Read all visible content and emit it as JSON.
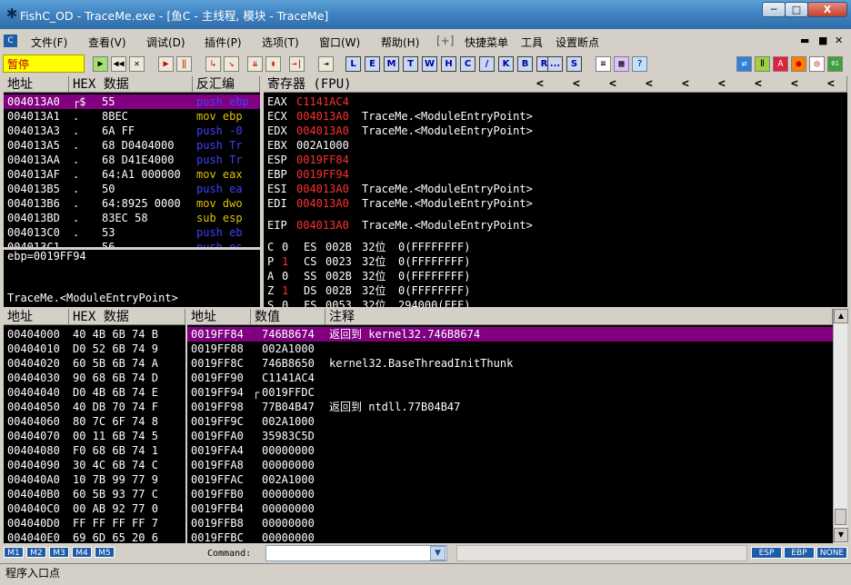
{
  "window": {
    "title": "FishC_OD - TraceMe.exe - [鱼C - 主线程, 模块 - TraceMe]",
    "app_icon": "bug-icon",
    "min": "─",
    "max": "□",
    "close": "X"
  },
  "menu": {
    "items": [
      "文件(F)",
      "查看(V)",
      "调试(D)",
      "插件(P)",
      "选项(T)",
      "窗口(W)",
      "帮助(H)",
      "[+]",
      "快捷菜单",
      "工具",
      "设置断点"
    ],
    "mdi_min": "▬",
    "mdi_max": "■",
    "mdi_close": "✕"
  },
  "toolbar": {
    "status": "暂停",
    "buttons": [
      "▶",
      "◀◀",
      "✕",
      "▶",
      "‖",
      "↳",
      "↘",
      "⇊",
      "⇟",
      "→|",
      "⇥"
    ],
    "letters": [
      "L",
      "E",
      "M",
      "T",
      "W",
      "H",
      "C",
      "/",
      "K",
      "B",
      "R",
      "...",
      "S"
    ],
    "right_icons": [
      "list-icon",
      "grid-icon",
      "help-icon",
      "refresh-icon",
      "bars-icon",
      "a-icon",
      "record-icon",
      "target-icon",
      "binary-icon"
    ]
  },
  "disasm": {
    "headers": [
      "地址",
      "HEX 数据",
      "反汇编"
    ],
    "rows": [
      {
        "addr": "004013A0",
        "mark": "┌$",
        "hex": "55",
        "asm": "push ebp",
        "color": "blue"
      },
      {
        "addr": "004013A1",
        "mark": ".",
        "hex": "8BEC",
        "asm": "mov ebp",
        "color": "yellow"
      },
      {
        "addr": "004013A3",
        "mark": ".",
        "hex": "6A FF",
        "asm": "push -0",
        "color": "blue"
      },
      {
        "addr": "004013A5",
        "mark": ".",
        "hex": "68 D0404000",
        "asm": "push Tr",
        "color": "blue"
      },
      {
        "addr": "004013AA",
        "mark": ".",
        "hex": "68 D41E4000",
        "asm": "push Tr",
        "color": "blue"
      },
      {
        "addr": "004013AF",
        "mark": ".",
        "hex": "64:A1 000000",
        "asm": "mov eax",
        "color": "yellow"
      },
      {
        "addr": "004013B5",
        "mark": ".",
        "hex": "50",
        "asm": "push ea",
        "color": "blue"
      },
      {
        "addr": "004013B6",
        "mark": ".",
        "hex": "64:8925 0000",
        "asm": "mov dwo",
        "color": "yellow"
      },
      {
        "addr": "004013BD",
        "mark": ".",
        "hex": "83EC 58",
        "asm": "sub esp",
        "color": "yellow"
      },
      {
        "addr": "004013C0",
        "mark": ".",
        "hex": "53",
        "asm": "push eb",
        "color": "blue"
      },
      {
        "addr": "004013C1",
        "mark": ".",
        "hex": "56",
        "asm": "push es",
        "color": "blue"
      }
    ],
    "info_line1": "ebp=0019FF94",
    "info_line2": "TraceMe.<ModuleEntryPoint>"
  },
  "registers": {
    "header": "寄存器 (FPU)",
    "arrows": [
      "<",
      "<",
      "<",
      "<",
      "<",
      "<",
      "<",
      "<",
      "<"
    ],
    "regs": [
      {
        "name": "EAX",
        "value": "C1141AC4",
        "desc": "",
        "red": true
      },
      {
        "name": "ECX",
        "value": "004013A0",
        "desc": "TraceMe.<ModuleEntryPoint>",
        "red": true
      },
      {
        "name": "EDX",
        "value": "004013A0",
        "desc": "TraceMe.<ModuleEntryPoint>",
        "red": true
      },
      {
        "name": "EBX",
        "value": "002A1000",
        "desc": "",
        "red": false
      },
      {
        "name": "ESP",
        "value": "0019FF84",
        "desc": "",
        "red": true
      },
      {
        "name": "EBP",
        "value": "0019FF94",
        "desc": "",
        "red": true
      },
      {
        "name": "ESI",
        "value": "004013A0",
        "desc": "TraceMe.<ModuleEntryPoint>",
        "red": true
      },
      {
        "name": "EDI",
        "value": "004013A0",
        "desc": "TraceMe.<ModuleEntryPoint>",
        "red": true
      }
    ],
    "eip": {
      "name": "EIP",
      "value": "004013A0",
      "desc": "TraceMe.<ModuleEntryPoint>"
    },
    "flags": [
      {
        "f": "C",
        "v": "0",
        "seg": "ES",
        "sel": "002B",
        "bits": "32位",
        "rest": "0(FFFFFFFF)",
        "red": false
      },
      {
        "f": "P",
        "v": "1",
        "seg": "CS",
        "sel": "0023",
        "bits": "32位",
        "rest": "0(FFFFFFFF)",
        "red": true
      },
      {
        "f": "A",
        "v": "0",
        "seg": "SS",
        "sel": "002B",
        "bits": "32位",
        "rest": "0(FFFFFFFF)",
        "red": false
      },
      {
        "f": "Z",
        "v": "1",
        "seg": "DS",
        "sel": "002B",
        "bits": "32位",
        "rest": "0(FFFFFFFF)",
        "red": true
      },
      {
        "f": "S",
        "v": "0",
        "seg": "FS",
        "sel": "0053",
        "bits": "32位",
        "rest": "294000(FFF)",
        "red": false
      }
    ]
  },
  "dump": {
    "headers": [
      "地址",
      "HEX 数据"
    ],
    "rows": [
      {
        "addr": "00404000",
        "hex": "40 4B 6B 74 B"
      },
      {
        "addr": "00404010",
        "hex": "D0 52 6B 74 9"
      },
      {
        "addr": "00404020",
        "hex": "60 5B 6B 74 A"
      },
      {
        "addr": "00404030",
        "hex": "90 68 6B 74 D"
      },
      {
        "addr": "00404040",
        "hex": "D0 4B 6B 74 E"
      },
      {
        "addr": "00404050",
        "hex": "40 DB 70 74 F"
      },
      {
        "addr": "00404060",
        "hex": "80 7C 6F 74 8"
      },
      {
        "addr": "00404070",
        "hex": "00 11 6B 74 5"
      },
      {
        "addr": "00404080",
        "hex": "F0 68 6B 74 1"
      },
      {
        "addr": "00404090",
        "hex": "30 4C 6B 74 C"
      },
      {
        "addr": "004040A0",
        "hex": "10 7B 99 77 9"
      },
      {
        "addr": "004040B0",
        "hex": "60 5B 93 77 C"
      },
      {
        "addr": "004040C0",
        "hex": "00 AB 92 77 0"
      },
      {
        "addr": "004040D0",
        "hex": "FF FF FF FF 7"
      },
      {
        "addr": "004040E0",
        "hex": "69 6D 65 20 6"
      }
    ]
  },
  "stack": {
    "headers": [
      "地址",
      "数值",
      "注释"
    ],
    "rows": [
      {
        "addr": "0019FF84",
        "mark": "",
        "val": "746B8674",
        "note": "返回到 kernel32.746B8674"
      },
      {
        "addr": "0019FF88",
        "mark": "",
        "val": "002A1000",
        "note": ""
      },
      {
        "addr": "0019FF8C",
        "mark": "",
        "val": "746B8650",
        "note": "kernel32.BaseThreadInitThunk"
      },
      {
        "addr": "0019FF90",
        "mark": "",
        "val": "C1141AC4",
        "note": ""
      },
      {
        "addr": "0019FF94",
        "mark": "┌",
        "val": "0019FFDC",
        "note": ""
      },
      {
        "addr": "0019FF98",
        "mark": "",
        "val": "77B04B47",
        "note": "返回到 ntdll.77B04B47"
      },
      {
        "addr": "0019FF9C",
        "mark": "",
        "val": "002A1000",
        "note": ""
      },
      {
        "addr": "0019FFA0",
        "mark": "",
        "val": "35983C5D",
        "note": ""
      },
      {
        "addr": "0019FFA4",
        "mark": "",
        "val": "00000000",
        "note": ""
      },
      {
        "addr": "0019FFA8",
        "mark": "",
        "val": "00000000",
        "note": ""
      },
      {
        "addr": "0019FFAC",
        "mark": "",
        "val": "002A1000",
        "note": ""
      },
      {
        "addr": "0019FFB0",
        "mark": "",
        "val": "00000000",
        "note": ""
      },
      {
        "addr": "0019FFB4",
        "mark": "",
        "val": "00000000",
        "note": ""
      },
      {
        "addr": "0019FFB8",
        "mark": "",
        "val": "00000000",
        "note": ""
      },
      {
        "addr": "0019FFBC",
        "mark": "",
        "val": "00000000",
        "note": ""
      }
    ]
  },
  "command": {
    "m_buttons": [
      "M1",
      "M2",
      "M3",
      "M4",
      "M5"
    ],
    "label": "Command:",
    "value": "",
    "right_buttons": [
      "ESP",
      "EBP",
      "NONE"
    ]
  },
  "status": {
    "text": "程序入口点"
  }
}
